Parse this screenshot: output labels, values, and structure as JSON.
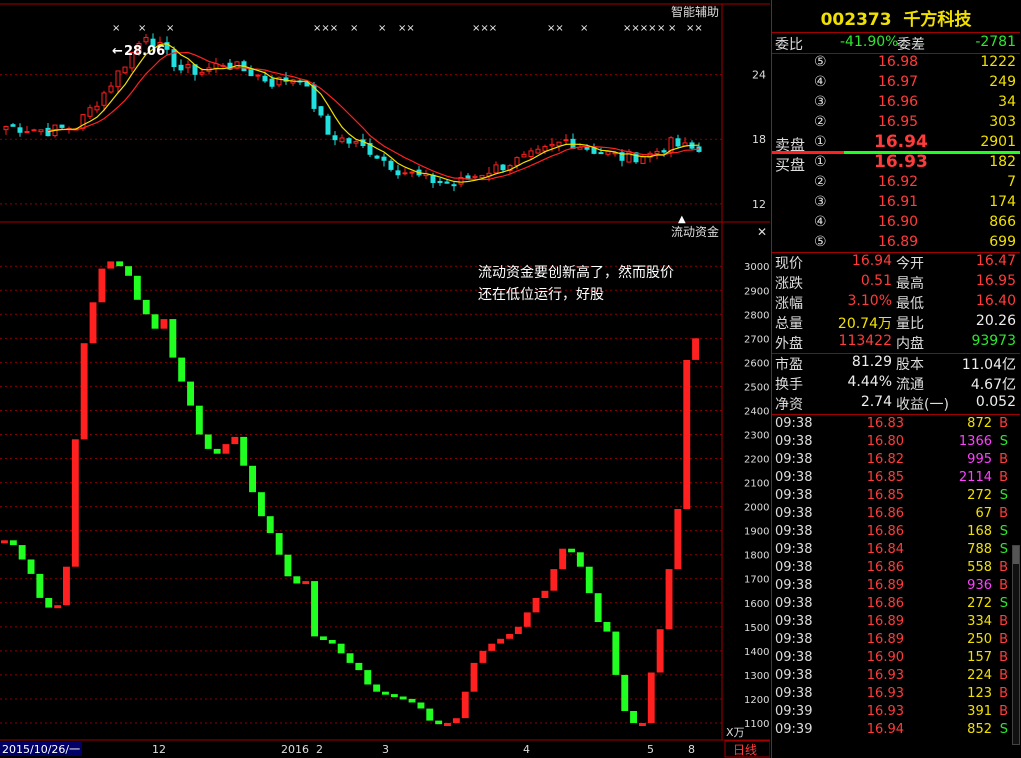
{
  "indicator_top": "智能辅助",
  "indicator_bottom": "流动资金",
  "peak_label": "28.06",
  "annotation_line1": "流动资金要创新高了，然而股价",
  "annotation_line2": "还在低位运行，好股",
  "close_icon": "✕",
  "x_axis": {
    "first": "2015/10/26/一",
    "labels": [
      "12",
      "2016",
      "2",
      "3",
      "4",
      "5",
      "8"
    ]
  },
  "period_label": "日线",
  "unit_label": "X万",
  "colors": {
    "up": "#ff2020",
    "down": "#20ff20",
    "ma_short": "#f0e000",
    "ma_long": "#ff2020",
    "grid": "#8b0000"
  },
  "chart_data": [
    {
      "type": "candlestick",
      "y_ticks": [
        24,
        18,
        12
      ],
      "ylim": [
        10.5,
        30
      ],
      "peak": 28.06,
      "signal_marks": [
        "×",
        "×",
        "×",
        "×××",
        "×",
        "×",
        "××",
        "×××",
        "××",
        "×",
        "××××",
        "×",
        "×",
        "××"
      ]
    },
    {
      "type": "bar",
      "title": "流动资金",
      "y_ticks": [
        3000,
        2900,
        2800,
        2700,
        2600,
        2500,
        2400,
        2300,
        2200,
        2100,
        2000,
        1900,
        1800,
        1700,
        1600,
        1500,
        1400,
        1300,
        1200,
        1100
      ],
      "ylim": [
        1050,
        3080
      ],
      "values": [
        1860,
        1840,
        1780,
        1720,
        1620,
        1580,
        1590,
        1750,
        2280,
        2680,
        2850,
        2990,
        3020,
        3000,
        2960,
        2860,
        2800,
        2740,
        2780,
        2620,
        2520,
        2420,
        2300,
        2240,
        2220,
        2260,
        2290,
        2170,
        2060,
        1960,
        1890,
        1800,
        1710,
        1680,
        1690,
        1460,
        1445,
        1430,
        1390,
        1350,
        1320,
        1260,
        1230,
        1220,
        1210,
        1200,
        1185,
        1160,
        1110,
        1095,
        1100,
        1120,
        1230,
        1350,
        1400,
        1430,
        1450,
        1470,
        1500,
        1560,
        1620,
        1650,
        1740,
        1825,
        1810,
        1750,
        1640,
        1520,
        1480,
        1300,
        1150,
        1100,
        1100,
        1310,
        1490,
        1740,
        1990,
        2610,
        2700
      ]
    }
  ],
  "stock": {
    "code": "002373",
    "name": "千方科技"
  },
  "weibi": {
    "label": "委比",
    "value": "-41.90%",
    "label2": "委差",
    "value2": "-2781"
  },
  "sell_label": "卖盘",
  "buy_label": "买盘",
  "sell_orders": [
    {
      "level": "⑤",
      "price": "16.98",
      "vol": "1222"
    },
    {
      "level": "④",
      "price": "16.97",
      "vol": "249"
    },
    {
      "level": "③",
      "price": "16.96",
      "vol": "34"
    },
    {
      "level": "②",
      "price": "16.95",
      "vol": "303"
    },
    {
      "level": "①",
      "price": "16.94",
      "vol": "2901"
    }
  ],
  "buy_orders": [
    {
      "level": "①",
      "price": "16.93",
      "vol": "182"
    },
    {
      "level": "②",
      "price": "16.92",
      "vol": "7"
    },
    {
      "level": "③",
      "price": "16.91",
      "vol": "174"
    },
    {
      "level": "④",
      "price": "16.90",
      "vol": "866"
    },
    {
      "level": "⑤",
      "price": "16.89",
      "vol": "699"
    }
  ],
  "quote": [
    {
      "l1": "现价",
      "v1": "16.94",
      "c1": "red",
      "l2": "今开",
      "v2": "16.47",
      "c2": "red"
    },
    {
      "l1": "涨跌",
      "v1": "0.51",
      "c1": "red",
      "l2": "最高",
      "v2": "16.95",
      "c2": "red"
    },
    {
      "l1": "涨幅",
      "v1": "3.10%",
      "c1": "red",
      "l2": "最低",
      "v2": "16.40",
      "c2": "red"
    },
    {
      "l1": "总量",
      "v1": "20.74万",
      "c1": "yellow",
      "l2": "量比",
      "v2": "20.26",
      "c2": "white"
    },
    {
      "l1": "外盘",
      "v1": "113422",
      "c1": "red",
      "l2": "内盘",
      "v2": "93973",
      "c2": "green"
    }
  ],
  "fundamentals": [
    {
      "l1": "市盈",
      "v1": "81.29",
      "l2": "股本",
      "v2": "11.04亿"
    },
    {
      "l1": "换手",
      "v1": "4.44%",
      "l2": "流通",
      "v2": "4.67亿"
    },
    {
      "l1": "净资",
      "v1": "2.74",
      "l2": "收益(一)",
      "v2": "0.052"
    }
  ],
  "trades": [
    {
      "time": "09:38",
      "price": "16.83",
      "vol": "872",
      "side": "B",
      "vc": "yellow"
    },
    {
      "time": "09:38",
      "price": "16.80",
      "vol": "1366",
      "side": "S",
      "vc": "magenta"
    },
    {
      "time": "09:38",
      "price": "16.82",
      "vol": "995",
      "side": "B",
      "vc": "magenta"
    },
    {
      "time": "09:38",
      "price": "16.85",
      "vol": "2114",
      "side": "B",
      "vc": "magenta"
    },
    {
      "time": "09:38",
      "price": "16.85",
      "vol": "272",
      "side": "S",
      "vc": "yellow"
    },
    {
      "time": "09:38",
      "price": "16.86",
      "vol": "67",
      "side": "B",
      "vc": "yellow"
    },
    {
      "time": "09:38",
      "price": "16.86",
      "vol": "168",
      "side": "S",
      "vc": "yellow"
    },
    {
      "time": "09:38",
      "price": "16.84",
      "vol": "788",
      "side": "S",
      "vc": "yellow"
    },
    {
      "time": "09:38",
      "price": "16.86",
      "vol": "558",
      "side": "B",
      "vc": "yellow"
    },
    {
      "time": "09:38",
      "price": "16.89",
      "vol": "936",
      "side": "B",
      "vc": "magenta"
    },
    {
      "time": "09:38",
      "price": "16.86",
      "vol": "272",
      "side": "S",
      "vc": "yellow"
    },
    {
      "time": "09:38",
      "price": "16.89",
      "vol": "334",
      "side": "B",
      "vc": "yellow"
    },
    {
      "time": "09:38",
      "price": "16.89",
      "vol": "250",
      "side": "B",
      "vc": "yellow"
    },
    {
      "time": "09:38",
      "price": "16.90",
      "vol": "157",
      "side": "B",
      "vc": "yellow"
    },
    {
      "time": "09:38",
      "price": "16.93",
      "vol": "224",
      "side": "B",
      "vc": "yellow"
    },
    {
      "time": "09:38",
      "price": "16.93",
      "vol": "123",
      "side": "B",
      "vc": "yellow"
    },
    {
      "time": "09:39",
      "price": "16.93",
      "vol": "391",
      "side": "B",
      "vc": "yellow"
    },
    {
      "time": "09:39",
      "price": "16.94",
      "vol": "852",
      "side": "S",
      "vc": "yellow"
    }
  ]
}
